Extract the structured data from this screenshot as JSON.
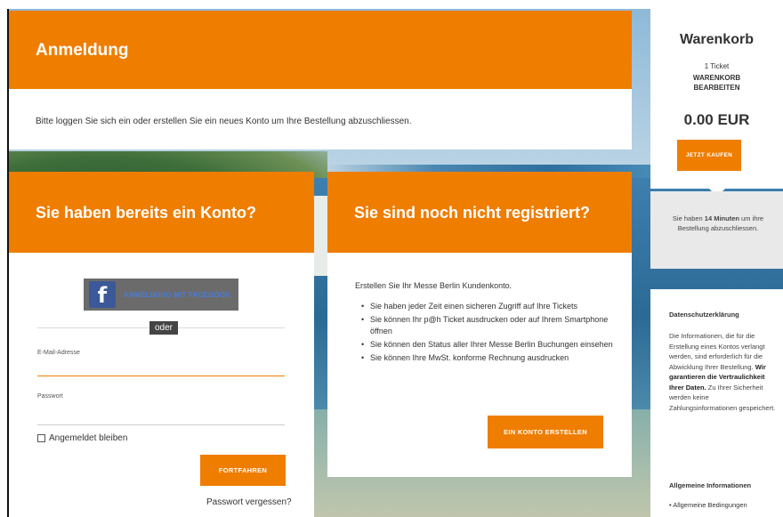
{
  "login_section": {
    "title": "Anmeldung",
    "instruction": "Bitte loggen Sie sich ein oder erstellen Sie ein neues Konto um Ihre Bestellung abzuschliessen."
  },
  "existing_account": {
    "title": "Sie haben bereits ein Konto?",
    "facebook_button": "ANMELDUNG MIT FACEBOOK",
    "facebook_icon": "facebook-icon",
    "or_label": "oder",
    "email_label": "E-Mail-Adresse",
    "email_value": "",
    "password_label": "Passwort",
    "password_value": "",
    "remember_label": "Angemeldet bleiben",
    "remember_checked": false,
    "continue_button": "FORTFAHREN",
    "forgot_link": "Passwort vergessen?"
  },
  "new_account": {
    "title": "Sie sind noch nicht registriert?",
    "intro": "Erstellen Sie Ihr Messe Berlin Kundenkonto.",
    "benefits": [
      "Sie haben jeder Zeit einen sicheren Zugriff auf Ihre Tickets",
      "Sie können Ihr p@h Ticket ausdrucken oder auf Ihrem Smartphone öffnen",
      "Sie können den Status aller Ihrer Messe Berlin Buchungen einsehen",
      "Sie können Ihre MwSt. konforme Rechnung ausdrucken"
    ],
    "create_button": "EIN KONTO ERSTELLEN"
  },
  "cart": {
    "title": "Warenkorb",
    "tickets": "1 Ticket",
    "edit_line1": "WARENKORB",
    "edit_line2": "BEARBEITEN",
    "price": "0.00 EUR",
    "buy_button": "JETZT KAUFEN",
    "timer_prefix": "Sie haben ",
    "timer_minutes": "14 Minuten",
    "timer_suffix": " um ihre Bestellung abzuschliessen."
  },
  "privacy": {
    "title": "Datenschutzerklärung",
    "text": "Die Informationen, die für die Erstellung eines Kontos verlangt werden, sind erforderlich für die Abwicklung Ihrer Bestellung.",
    "bold": "Wir garantieren die Vertraulichkeit Ihrer Daten.",
    "text2": "Zu Ihrer Sicherheit werden keine Zahlungsinformationen gespeichert.",
    "general_title": "Allgemeine Informationen",
    "general_item": "Allgemeine Bedingungen"
  },
  "colors": {
    "accent": "#ef7d00",
    "facebook": "#3b5998"
  }
}
